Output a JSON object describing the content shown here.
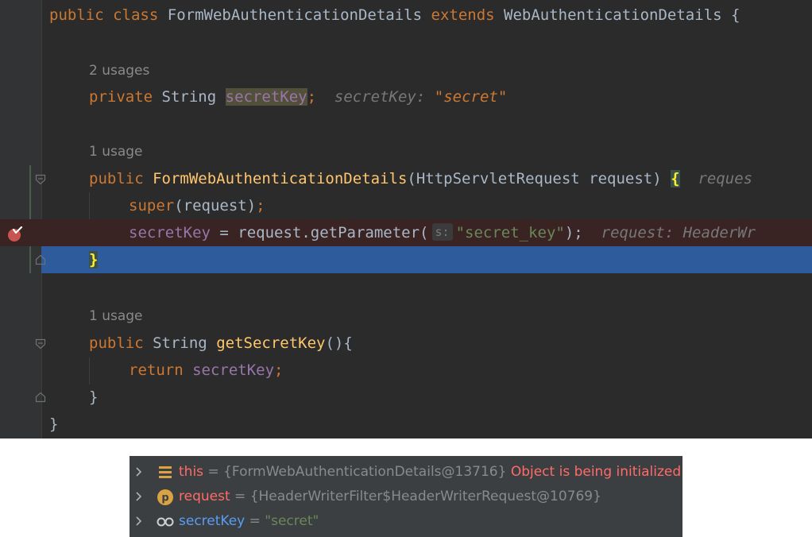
{
  "editor": {
    "class_decl": {
      "kw_public": "public",
      "kw_class": "class",
      "class_name": "FormWebAuthenticationDetails",
      "kw_extends": "extends",
      "parent": "WebAuthenticationDetails",
      "brace": "{"
    },
    "field_usages": "2 usages",
    "field_decl": {
      "kw_private": "private",
      "type": "String",
      "name": "secretKey",
      "semicolon": ";",
      "inline_label": "secretKey:",
      "inline_value": "\"secret\""
    },
    "ctor_usages": "1 usage",
    "ctor_decl": {
      "kw_public": "public",
      "name": "FormWebAuthenticationDetails",
      "params": "(HttpServletRequest request) ",
      "brace": "{",
      "inline_hint": "reques"
    },
    "super_call": {
      "kw_super": "super",
      "args": "(request)",
      "semicolon": ";"
    },
    "assign": {
      "field": "secretKey",
      "op": " = request.getParameter(",
      "param_hint": "s:",
      "str": "\"secret_key\"",
      "close": ");",
      "inline_hint": "request: HeaderWr"
    },
    "ctor_close": "}",
    "getter_usages": "1 usage",
    "getter_decl": {
      "kw_public": "public",
      "type": "String",
      "name": "getSecretKey",
      "rest": "(){"
    },
    "return_stmt": {
      "kw_return": "return",
      "field": "secretKey",
      "semicolon": ";"
    },
    "getter_close": "}",
    "class_close": "}"
  },
  "debugger": {
    "variables": [
      {
        "icon": "field-list-icon",
        "name": "this",
        "eq": "=",
        "value": "{FormWebAuthenticationDetails@13716}",
        "warning": "Object is being initialized"
      },
      {
        "icon": "parameter-icon",
        "icon_letter": "p",
        "name": "request",
        "eq": "=",
        "value": "{HeaderWriterFilter$HeaderWriterRequest@10769}"
      },
      {
        "icon": "watch-glasses-icon",
        "name": "secretKey",
        "eq": "=",
        "value": "\"secret\""
      }
    ]
  },
  "colors": {
    "editor_bg": "#2b2b2b",
    "keyword": "#cc7832",
    "field": "#9876aa",
    "method": "#ffc66d",
    "string": "#6a8759",
    "execution_line": "#2d5b9b",
    "breakpoint_line": "#3a2323",
    "breakpoint": "#c75450"
  }
}
